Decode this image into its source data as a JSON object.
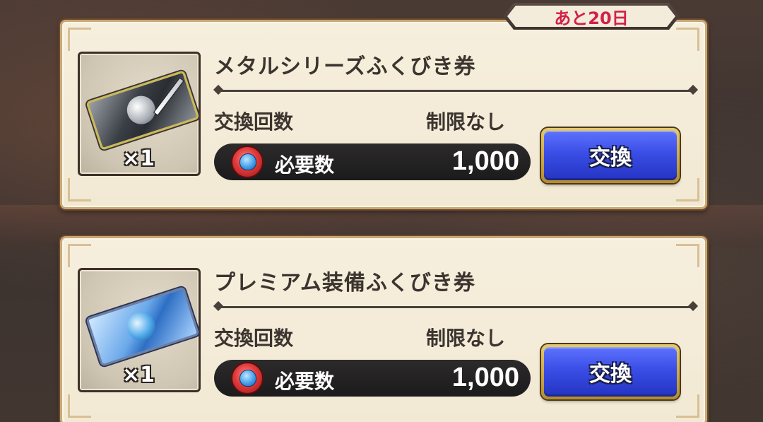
{
  "banner": {
    "days_left": "あと20日"
  },
  "items": [
    {
      "title": "メタルシリーズふくびき券",
      "quantity": "×1",
      "limit_label": "交換回数",
      "limit_value": "制限なし",
      "cost_label": "必要数",
      "cost_value": "1,000",
      "button_label": "交換",
      "ticket_type": "metal"
    },
    {
      "title": "プレミアム装備ふくびき券",
      "quantity": "×1",
      "limit_label": "交換回数",
      "limit_value": "制限なし",
      "cost_label": "必要数",
      "cost_value": "1,000",
      "button_label": "交換",
      "ticket_type": "premium"
    }
  ],
  "colors": {
    "button_blue": "#3a4ee6",
    "banner_text": "#d2204a",
    "card_bg": "#f6efdd"
  }
}
